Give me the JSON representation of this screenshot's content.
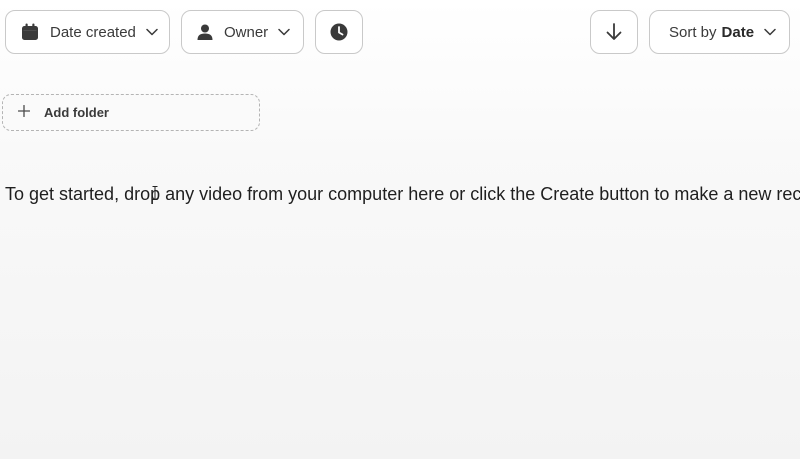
{
  "toolbar": {
    "date_filter": {
      "label": "Date created",
      "icon": "calendar-icon"
    },
    "owner_filter": {
      "label": "Owner",
      "icon": "person-icon"
    },
    "history_button": {
      "icon": "clock-icon"
    },
    "sort_direction_button": {
      "icon": "arrow-down-icon"
    },
    "sort": {
      "prefix": "Sort by",
      "value": "Date",
      "icon": "chevron-down-icon"
    }
  },
  "folders": {
    "add_label": "Add folder",
    "icon": "plus-icon"
  },
  "empty_state": {
    "message": "To get started, drop any video from your computer here or click the Create button to make a new recording."
  }
}
